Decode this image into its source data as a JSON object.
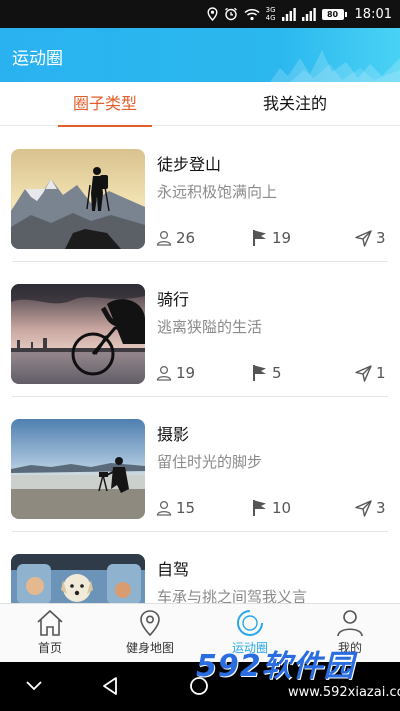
{
  "status_bar": {
    "time": "18:01",
    "battery": "80",
    "network_top": "3G",
    "network_bottom": "4G"
  },
  "header": {
    "title": "运动圈"
  },
  "tabs": [
    {
      "label": "圈子类型",
      "active": true
    },
    {
      "label": "我关注的",
      "active": false
    }
  ],
  "circles": [
    {
      "title": "徒步登山",
      "subtitle": "永远积极饱满向上",
      "members": "26",
      "posts": "19",
      "shares": "3",
      "thumbnail": "hiker-on-summit"
    },
    {
      "title": "骑行",
      "subtitle": "逃离狭隘的生活",
      "members": "19",
      "posts": "5",
      "shares": "1",
      "thumbnail": "cyclist-at-sunset"
    },
    {
      "title": "摄影",
      "subtitle": "留住时光的脚步",
      "members": "15",
      "posts": "10",
      "shares": "3",
      "thumbnail": "photographer-on-beach"
    },
    {
      "title": "自驾",
      "subtitle": "车承与挑之间驾我义言",
      "members": "",
      "posts": "",
      "shares": "",
      "thumbnail": "dog-in-car"
    }
  ],
  "bottom_nav": [
    {
      "label": "首页",
      "icon": "home-icon",
      "active": false
    },
    {
      "label": "健身地图",
      "icon": "map-pin-icon",
      "active": false
    },
    {
      "label": "运动圈",
      "icon": "circle-icon",
      "active": true
    },
    {
      "label": "我的",
      "icon": "user-icon",
      "active": false
    }
  ],
  "watermark": {
    "logo": "592软件园",
    "url": "www.592xiazai.com"
  },
  "colors": {
    "header": "#2ab2f0",
    "tab_active": "#e05f2b",
    "nav_active": "#29a8e8"
  }
}
